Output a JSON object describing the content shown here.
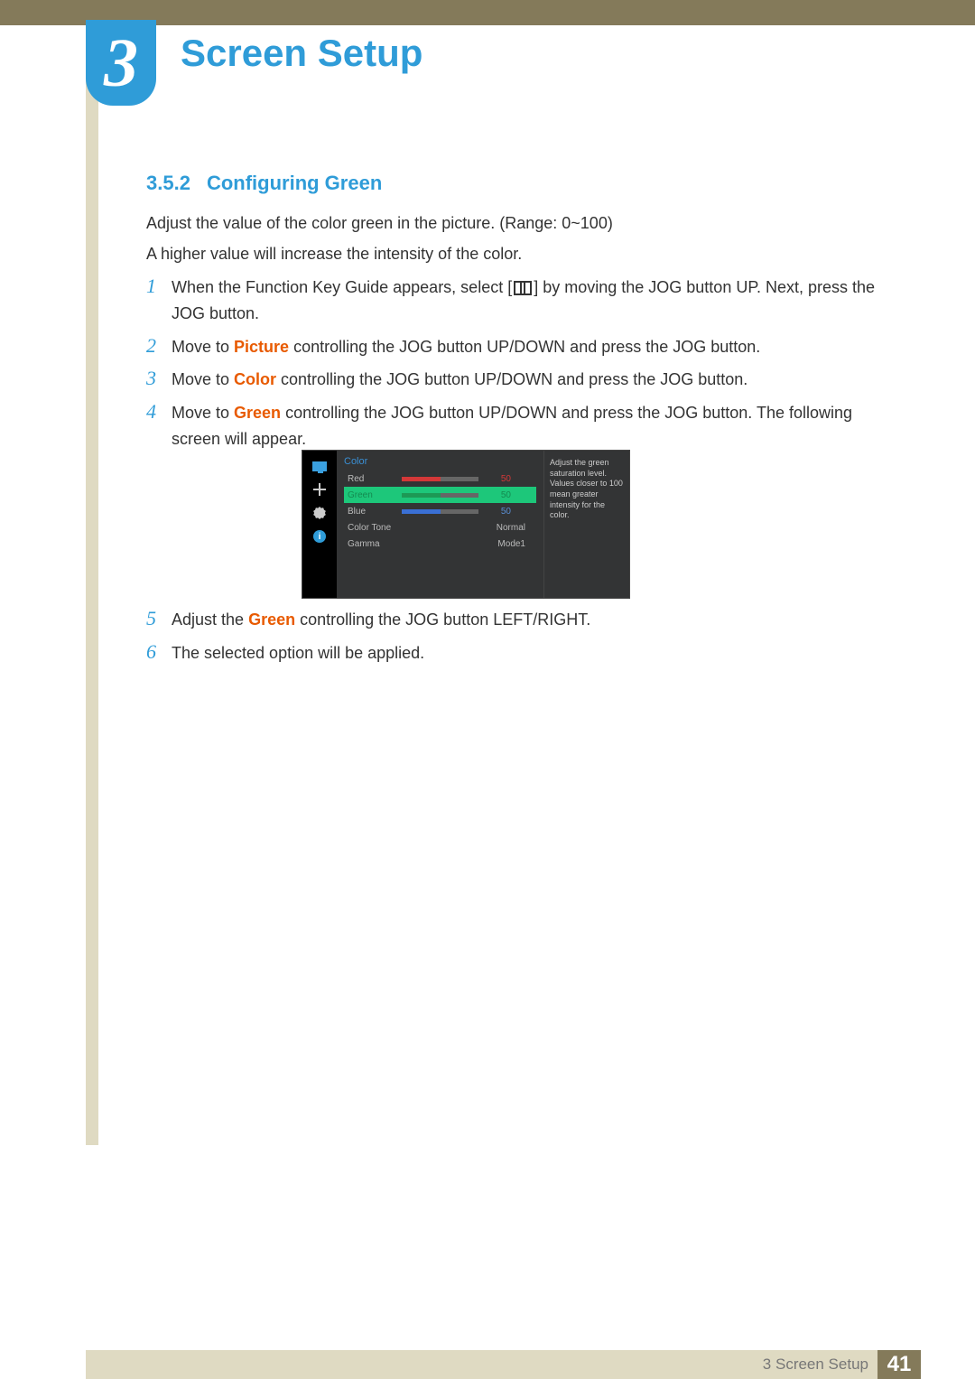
{
  "chapter": {
    "number": "3",
    "title": "Screen Setup"
  },
  "section": {
    "number": "3.5.2",
    "title": "Configuring Green"
  },
  "intro": {
    "line1": "Adjust the value of the color green in the picture. (Range: 0~100)",
    "line2": "A higher value will increase the intensity of the color."
  },
  "steps": {
    "s1a": "When the Function Key Guide appears, select [",
    "s1b": "] by moving the JOG button UP. Next, press the JOG button.",
    "s2a": "Move to ",
    "s2hl": "Picture",
    "s2b": " controlling the JOG button UP/DOWN and press the JOG button.",
    "s3a": "Move to ",
    "s3hl": "Color",
    "s3b": " controlling the JOG button UP/DOWN and press the JOG button.",
    "s4a": "Move to ",
    "s4hl": "Green",
    "s4b": " controlling the JOG button UP/DOWN and press the JOG button. The following screen will appear.",
    "s5a": "Adjust the ",
    "s5hl": "Green",
    "s5b": " controlling the JOG button LEFT/RIGHT.",
    "s6": "The selected option will be applied."
  },
  "stepNums": {
    "n1": "1",
    "n2": "2",
    "n3": "3",
    "n4": "4",
    "n5": "5",
    "n6": "6"
  },
  "osd": {
    "title": "Color",
    "rows": {
      "red": {
        "label": "Red",
        "value": "50"
      },
      "green": {
        "label": "Green",
        "value": "50"
      },
      "blue": {
        "label": "Blue",
        "value": "50"
      },
      "colortone": {
        "label": "Color Tone",
        "value": "Normal"
      },
      "gamma": {
        "label": "Gamma",
        "value": "Mode1"
      }
    },
    "help": "Adjust the green saturation level. Values closer to 100 mean greater intensity for the color.",
    "info_glyph": "i"
  },
  "footer": {
    "text": "3 Screen Setup",
    "page": "41"
  }
}
